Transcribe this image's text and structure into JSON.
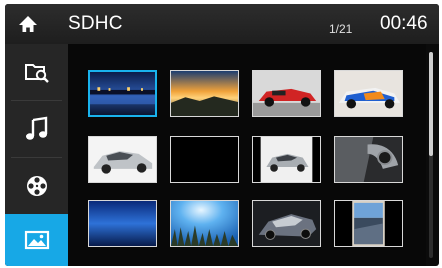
{
  "header": {
    "title": "SDHC",
    "page_counter": "1/21",
    "clock": "00:46",
    "home_icon": "home-icon"
  },
  "sidebar": {
    "items": [
      {
        "icon": "folder-search-icon",
        "active": false
      },
      {
        "icon": "music-note-icon",
        "active": false
      },
      {
        "icon": "film-reel-icon",
        "active": false
      },
      {
        "icon": "picture-icon",
        "active": true
      }
    ]
  },
  "gallery": {
    "selected_index": 0,
    "thumbnails": [
      {
        "subject": "lake-night-city"
      },
      {
        "subject": "sunset-landscape"
      },
      {
        "subject": "red-race-car"
      },
      {
        "subject": "rally-car"
      },
      {
        "subject": "silver-sedan"
      },
      {
        "subject": "black-empty"
      },
      {
        "subject": "silver-car-studio"
      },
      {
        "subject": "car-interior"
      },
      {
        "subject": "blue-gradient"
      },
      {
        "subject": "sky-grass"
      },
      {
        "subject": "car-dark-studio"
      },
      {
        "subject": "portrait-landscape"
      }
    ]
  },
  "colors": {
    "accent": "#17a8e6",
    "background": "#0b0b0b",
    "sidebar": "#262626"
  },
  "scroll": {
    "position_fraction": 0.0,
    "visible_fraction": 0.5
  }
}
